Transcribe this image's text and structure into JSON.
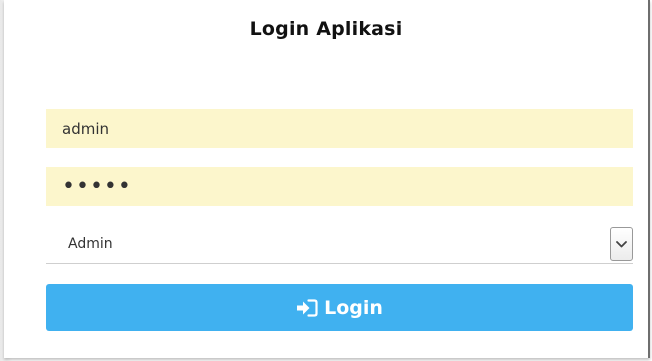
{
  "form": {
    "title": "Login Aplikasi",
    "username_value": "admin",
    "password_value": "admin",
    "role_selected": "Admin",
    "login_label": "Login"
  },
  "icons": {
    "login": "sign-in-icon",
    "dropdown": "chevron-down-icon"
  },
  "colors": {
    "input_autofill_bg": "#fcf6cc",
    "button_bg": "#40b1f0",
    "button_text": "#ffffff"
  }
}
